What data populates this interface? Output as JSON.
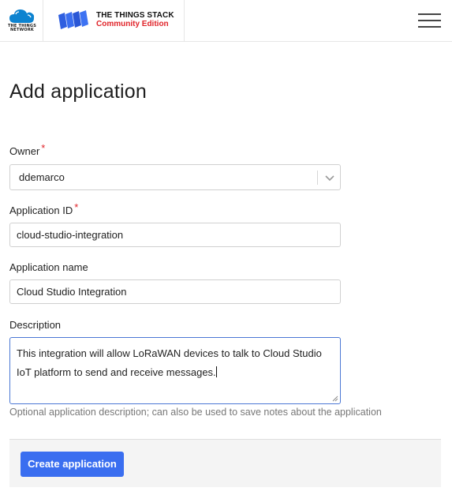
{
  "header": {
    "ttn_logo_text_line1": "THE THINGS",
    "ttn_logo_text_line2": "NETWORK",
    "stack_title": "THE THINGS STACK",
    "stack_edition": "Community Edition",
    "menu_icon": "hamburger-menu-icon"
  },
  "page": {
    "title": "Add application"
  },
  "form": {
    "owner": {
      "label": "Owner",
      "required_mark": "*",
      "value": "ddemarco"
    },
    "application_id": {
      "label": "Application ID",
      "required_mark": "*",
      "value": "cloud-studio-integration"
    },
    "application_name": {
      "label": "Application name",
      "value": "Cloud Studio Integration"
    },
    "description": {
      "label": "Description",
      "value": "This integration will allow LoRaWAN devices to talk to Cloud Studio IoT platform to send and receive messages.",
      "hint": "Optional application description; can also be used to save notes about the application"
    },
    "submit_label": "Create application"
  },
  "colors": {
    "accent": "#3a6ef0",
    "required": "#e0242a",
    "focus_border": "#4a77d4",
    "ttn_blue": "#0d83d0",
    "stack_blue": "#2f5fe0"
  }
}
